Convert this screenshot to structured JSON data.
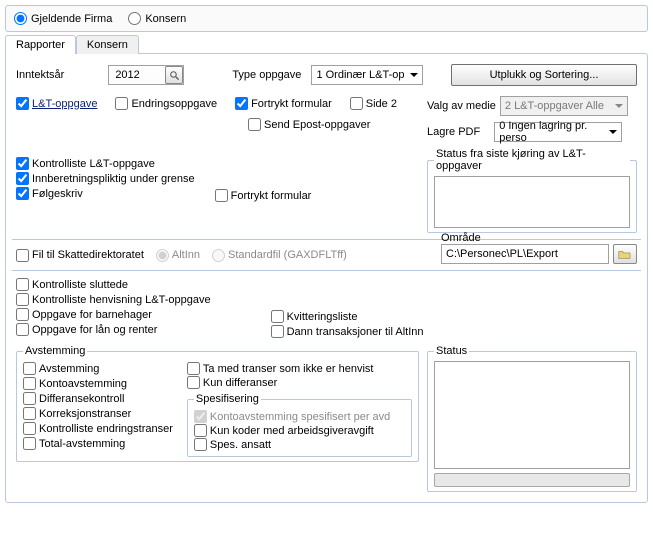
{
  "top": {
    "current_company": "Gjeldende Firma",
    "group": "Konsern"
  },
  "tabs": {
    "reports": "Rapporter",
    "group": "Konsern"
  },
  "main": {
    "income_year_label": "Inntektsår",
    "income_year": "2012",
    "task_type_label": "Type oppgave",
    "task_type": "1 Ordinær L&T-op",
    "select_sort_btn": "Utplukk og Sortering...",
    "lt_task": "L&T-oppgave",
    "change_task": "Endringsoppgave",
    "preprinted_form": "Fortrykt formular",
    "page2": "Side 2",
    "media_label": "Valg av medie",
    "media_value": "2 L&T-oppgaver Alle",
    "send_email": "Send Epost-oppgaver",
    "save_pdf_label": "Lagre PDF",
    "save_pdf_value": "0 Ingen lagring pr. perso",
    "status_legend": "Status fra siste kjøring av L&T-oppgaver",
    "check_lt": "Kontrolliste L&T-oppgave",
    "report_under_limit": "Innberetningspliktig under grense",
    "cover_letter": "Følgeskriv",
    "preprinted_form2": "Fortrykt formular",
    "file_to_tax": "Fil til Skattedirektoratet",
    "altinn": "AltInn",
    "standardfile": "Standardfil (GAXDFLTff)",
    "area_label": "Område",
    "area_path": "C:\\Personec\\PL\\Export",
    "checklist_closed": "Kontrolliste sluttede",
    "checklist_ref_lt": "Kontrolliste henvisning L&T-oppgave",
    "task_kindergarten": "Oppgave for barnehager",
    "task_loans": "Oppgave for lån og renter",
    "receipt_list": "Kvitteringsliste",
    "make_trans_altinn": "Dann transaksjoner til AltInn"
  },
  "recon": {
    "legend": "Avstemming",
    "avstemming": "Avstemming",
    "kontoavstemming": "Kontoavstemming",
    "diffkontroll": "Differansekontroll",
    "korreksjon": "Korreksjonstranser",
    "kontroll_endring": "Kontrolliste endringstranser",
    "total": "Total-avstemming",
    "ta_med": "Ta med transer som ikke er henvist",
    "kun_diff": "Kun differanser",
    "spes_legend": "Spesifisering",
    "spes1": "Kontoavstemming spesifisert per avd",
    "spes2": "Kun koder med arbeidsgiveravgift",
    "spes3": "Spes. ansatt"
  },
  "status": {
    "legend": "Status"
  }
}
